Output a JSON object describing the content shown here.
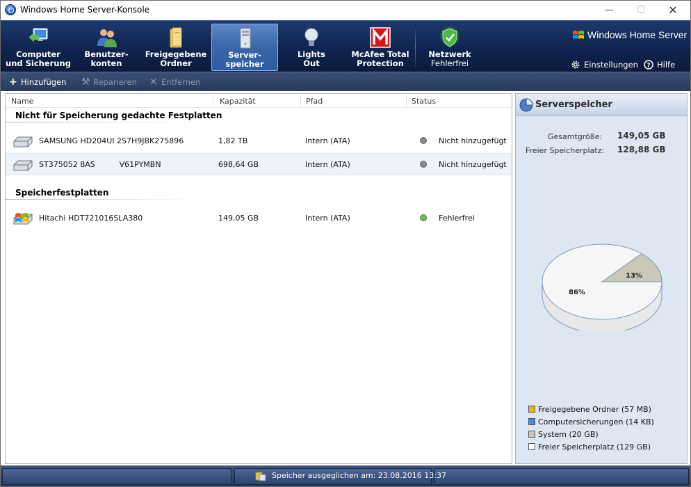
{
  "window": {
    "title": "Windows Home Server-Konsole",
    "minimize": "—",
    "maximize": "☐",
    "close": "✕"
  },
  "nav": {
    "tabs": [
      {
        "label": "Computer\nund Sicherung",
        "icon": "computer-backup-icon"
      },
      {
        "label": "Benutzer-\nkonten",
        "icon": "users-icon"
      },
      {
        "label": "Freigegebene\nOrdner",
        "icon": "shared-folder-icon"
      },
      {
        "label": "Server-\nspeicher",
        "icon": "server-storage-icon"
      },
      {
        "label": "Lights\nOut",
        "icon": "lightbulb-icon"
      },
      {
        "label": "McAfee Total\nProtection",
        "icon": "mcafee-icon"
      }
    ],
    "network": {
      "label": "Netzwerk",
      "status": "Fehlerfrei",
      "icon": "shield-check-icon"
    },
    "brand": "Windows Home Server",
    "settings": "Einstellungen",
    "help": "Hilfe"
  },
  "toolbar": {
    "add": "Hinzufügen",
    "repair": "Reparieren",
    "remove": "Entfernen"
  },
  "columns": {
    "name": "Name",
    "capacity": "Kapazität",
    "path": "Pfad",
    "status": "Status"
  },
  "groups": [
    {
      "title": "Nicht für Speicherung gedachte Festplatten",
      "rows": [
        {
          "name": "SAMSUNG HD204UI 2S7H9JBK275896",
          "capacity": "1,82 TB",
          "path": "Intern (ATA)",
          "status": "Nicht hinzugefügt",
          "status_color": "#8a8a8a"
        },
        {
          "name": "ST375052 8AS          V61PYMBN",
          "capacity": "698,64 GB",
          "path": "Intern (ATA)",
          "status": "Nicht hinzugefügt",
          "status_color": "#8a8a8a"
        }
      ]
    },
    {
      "title": "Speicherfestplatten",
      "rows": [
        {
          "name": "Hitachi HDT721016SLA380",
          "capacity": "149,05 GB",
          "path": "Intern (ATA)",
          "status": "Fehlerfrei",
          "status_color": "#6cc04a"
        }
      ]
    }
  ],
  "info": {
    "title": "Serverspeicher",
    "total_label": "Gesamtgröße:",
    "total_value": "149,05 GB",
    "free_label": "Freier Speicherplatz:",
    "free_value": "128,88 GB",
    "pie": {
      "used_label": "13%",
      "free_label": "86%",
      "used_percent": 13.5
    },
    "legend": [
      {
        "label": "Freigegebene Ordner (57 MB)",
        "color": "#f0b400"
      },
      {
        "label": "Computersicherungen (14 KB)",
        "color": "#3f8ee8"
      },
      {
        "label": "System (20 GB)",
        "color": "#c9c7b6"
      },
      {
        "label": "Freier Speicherplatz (129 GB)",
        "color": "#ffffff"
      }
    ]
  },
  "statusbar": {
    "text": "Speicher ausgeglichen am: 23.08.2016 13:37"
  },
  "colors": {
    "header": "#0f2450",
    "active_tab": "#3b67aa",
    "toolbar": "#2a3a5c"
  }
}
